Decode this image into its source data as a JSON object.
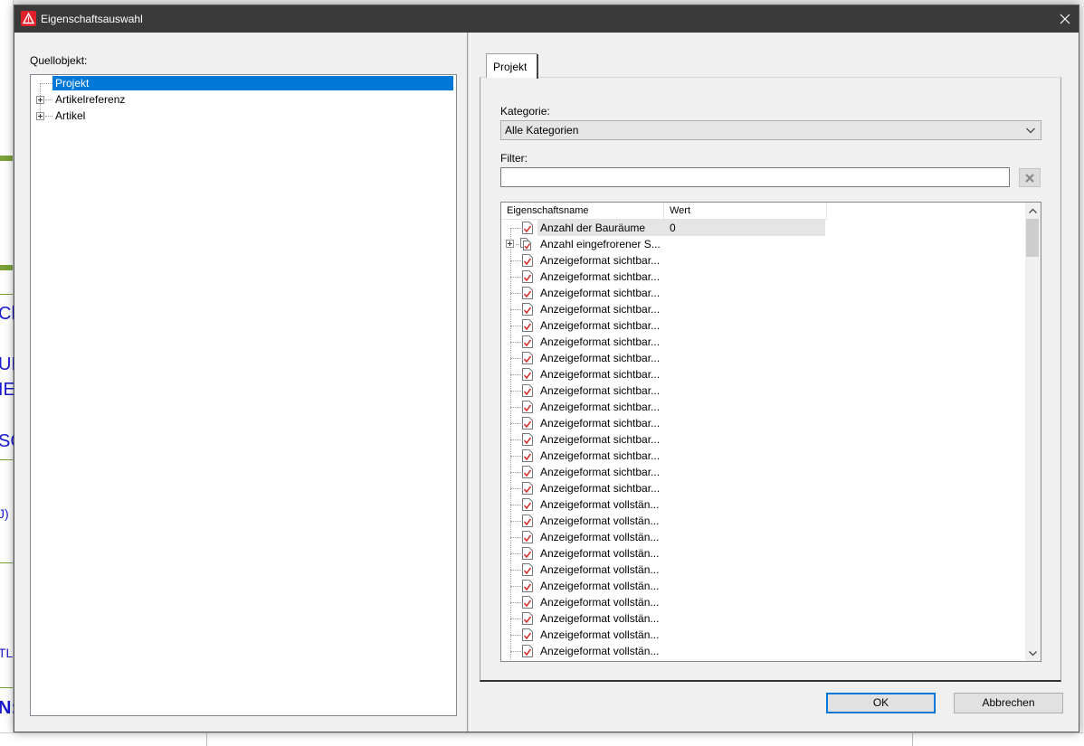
{
  "dialog": {
    "title": "Eigenschaftsauswahl"
  },
  "left": {
    "source_label": "Quellobjekt:",
    "tree": [
      {
        "label": "Projekt",
        "selected": true,
        "expandable": false
      },
      {
        "label": "Artikelreferenz",
        "selected": false,
        "expandable": true
      },
      {
        "label": "Artikel",
        "selected": false,
        "expandable": true
      }
    ]
  },
  "right": {
    "tab_label": "Projekt",
    "category_label": "Kategorie:",
    "category_value": "Alle Kategorien",
    "filter_label": "Filter:",
    "filter_value": "",
    "grid": {
      "col_name": "Eigenschaftsname",
      "col_value": "Wert",
      "rows": [
        {
          "name": "Anzahl der Bauräume",
          "value": "0",
          "highlighted": true,
          "expandable": false,
          "multi": false
        },
        {
          "name": "Anzahl eingefrorener S...",
          "value": "",
          "highlighted": false,
          "expandable": true,
          "multi": true
        },
        {
          "name": "Anzeigeformat sichtbar...",
          "value": ""
        },
        {
          "name": "Anzeigeformat sichtbar...",
          "value": ""
        },
        {
          "name": "Anzeigeformat sichtbar...",
          "value": ""
        },
        {
          "name": "Anzeigeformat sichtbar...",
          "value": ""
        },
        {
          "name": "Anzeigeformat sichtbar...",
          "value": ""
        },
        {
          "name": "Anzeigeformat sichtbar...",
          "value": ""
        },
        {
          "name": "Anzeigeformat sichtbar...",
          "value": ""
        },
        {
          "name": "Anzeigeformat sichtbar...",
          "value": ""
        },
        {
          "name": "Anzeigeformat sichtbar...",
          "value": ""
        },
        {
          "name": "Anzeigeformat sichtbar...",
          "value": ""
        },
        {
          "name": "Anzeigeformat sichtbar...",
          "value": ""
        },
        {
          "name": "Anzeigeformat sichtbar...",
          "value": ""
        },
        {
          "name": "Anzeigeformat sichtbar...",
          "value": ""
        },
        {
          "name": "Anzeigeformat sichtbar...",
          "value": ""
        },
        {
          "name": "Anzeigeformat sichtbar...",
          "value": ""
        },
        {
          "name": "Anzeigeformat vollstän...",
          "value": ""
        },
        {
          "name": "Anzeigeformat vollstän...",
          "value": ""
        },
        {
          "name": "Anzeigeformat vollstän...",
          "value": ""
        },
        {
          "name": "Anzeigeformat vollstän...",
          "value": ""
        },
        {
          "name": "Anzeigeformat vollstän...",
          "value": ""
        },
        {
          "name": "Anzeigeformat vollstän...",
          "value": ""
        },
        {
          "name": "Anzeigeformat vollstän...",
          "value": ""
        },
        {
          "name": "Anzeigeformat vollstän...",
          "value": ""
        },
        {
          "name": "Anzeigeformat vollstän...",
          "value": ""
        },
        {
          "name": "Anzeigeformat vollstän...",
          "value": ""
        }
      ]
    }
  },
  "buttons": {
    "ok": "OK",
    "cancel": "Abbrechen"
  },
  "background": {
    "fragments": [
      "Cl",
      "UN",
      "IE",
      "SC",
      "J)",
      "TL",
      "N:"
    ]
  },
  "colors": {
    "selection": "#0078d7",
    "titlebar": "#3a3a3a",
    "warning_icon": "#e0202a",
    "background_text": "#1a1ad0"
  }
}
